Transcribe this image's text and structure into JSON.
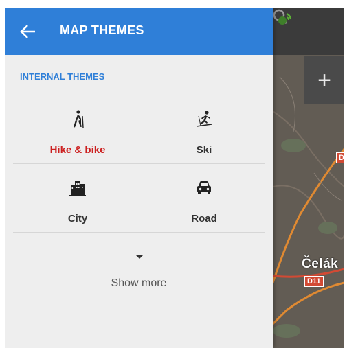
{
  "header": {
    "title": "MAP THEMES",
    "back_icon": "arrow-left-icon"
  },
  "section": {
    "title": "INTERNAL THEMES"
  },
  "themes": [
    {
      "label": "Hike & bike",
      "icon": "hiker-icon",
      "selected": true
    },
    {
      "label": "Ski",
      "icon": "skier-icon",
      "selected": false
    },
    {
      "label": "City",
      "icon": "buildings-icon",
      "selected": false
    },
    {
      "label": "Road",
      "icon": "car-icon",
      "selected": false
    }
  ],
  "show_more": {
    "label": "Show more",
    "icon": "triangle-down-icon"
  },
  "map": {
    "town_label": "Čelák",
    "road_badges": [
      "D",
      "D11"
    ],
    "zoom_in_label": "+"
  },
  "colors": {
    "accent": "#2f7fd8",
    "selected_text": "#cc1f1f",
    "drawer_bg": "#eeeeee"
  }
}
